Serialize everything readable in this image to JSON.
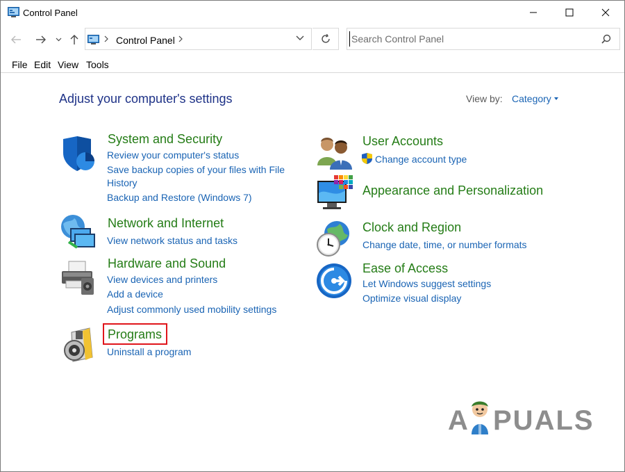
{
  "window": {
    "title": "Control Panel",
    "controls": {
      "minimize": "—",
      "maximize": "☐",
      "close": "✕"
    }
  },
  "nav": {
    "back": "←",
    "forward": "→",
    "recent": "⌄",
    "up": "↑",
    "address": {
      "path": "Control Panel"
    },
    "refresh": "↻",
    "search": {
      "placeholder": "Search Control Panel"
    }
  },
  "menu": {
    "items": [
      "File",
      "Edit",
      "View",
      "Tools"
    ]
  },
  "content": {
    "heading": "Adjust your computer's settings",
    "view_by": {
      "label": "View by:",
      "value": "Category"
    },
    "categories_left": [
      {
        "title": "System and Security",
        "icon": "shield-icon",
        "links": [
          "Review your computer's status",
          "Save backup copies of your files with File",
          "History",
          "Backup and Restore (Windows 7)"
        ]
      },
      {
        "title": "Network and Internet",
        "icon": "network-globe-icon",
        "links": [
          "View network status and tasks"
        ]
      },
      {
        "title": "Hardware and Sound",
        "icon": "printer-speaker-icon",
        "links": [
          "View devices and printers",
          "Add a device",
          "Adjust commonly used mobility settings"
        ]
      },
      {
        "title": "Programs",
        "icon": "programs-disc-icon",
        "links": [
          "Uninstall a program"
        ]
      }
    ],
    "categories_right": [
      {
        "title": "User Accounts",
        "icon": "users-icon",
        "links": [
          "Change account type"
        ]
      },
      {
        "title": "Appearance and Personalization",
        "icon": "monitor-palette-icon",
        "links": []
      },
      {
        "title": "Clock and Region",
        "icon": "clock-globe-icon",
        "links": [
          "Change date, time, or number formats"
        ]
      },
      {
        "title": "Ease of Access",
        "icon": "ease-of-access-icon",
        "links": [
          "Let Windows suggest settings",
          "Optimize visual display"
        ]
      }
    ]
  },
  "watermark": {
    "left": "A",
    "right": "PUALS"
  },
  "colors": {
    "heading": "#1e3287",
    "category_title": "#247c16",
    "link": "#1a64b4",
    "highlight": "#e0151b"
  }
}
